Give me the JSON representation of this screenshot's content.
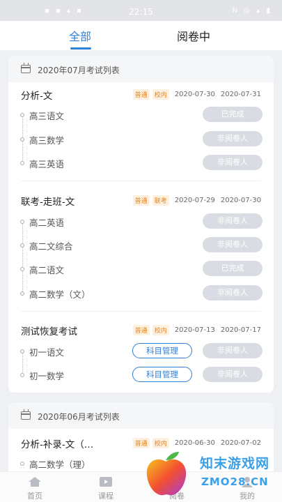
{
  "status_bar": {
    "time": "22:15",
    "left_icons": "▪ ▪ ▴ ▪",
    "right_icons": "N ◎ ▴ ▮"
  },
  "tabs": [
    {
      "label": "全部",
      "active": true
    },
    {
      "label": "阅卷中",
      "active": false
    }
  ],
  "sections": [
    {
      "header": "2020年07月考试列表",
      "exams": [
        {
          "title": "分析-文",
          "badges": [
            "普通",
            "校内"
          ],
          "start_date": "2020-07-30",
          "end_date": "2020-07-31",
          "subjects": [
            {
              "name": "高三语文",
              "status": "已完成"
            },
            {
              "name": "高三数学",
              "status": "非阅卷人"
            },
            {
              "name": "高三英语",
              "status": "非阅卷人"
            }
          ]
        },
        {
          "title": "联考-走班-文",
          "badges": [
            "普通",
            "联考"
          ],
          "start_date": "2020-07-29",
          "end_date": "2020-07-30",
          "subjects": [
            {
              "name": "高二英语",
              "status": "非阅卷人"
            },
            {
              "name": "高二文综合",
              "status": "非阅卷人"
            },
            {
              "name": "高二语文",
              "status": "已完成"
            },
            {
              "name": "高二数学（文）",
              "status": "非阅卷人"
            }
          ]
        },
        {
          "title": "测试恢复考试",
          "badges": [
            "普通",
            "校内"
          ],
          "start_date": "2020-07-13",
          "end_date": "2020-07-17",
          "subjects": [
            {
              "name": "初一语文",
              "action": "科目管理",
              "status": "非阅卷人"
            },
            {
              "name": "初一数学",
              "action": "科目管理",
              "status": "非阅卷人"
            }
          ]
        }
      ]
    },
    {
      "header": "2020年06月考试列表",
      "exams": [
        {
          "title": "分析-补录-文（…",
          "badges": [
            "普通",
            "校内"
          ],
          "start_date": "2020-06-30",
          "end_date": "2020-07-02",
          "subjects": [
            {
              "name": "高二数学（理）"
            }
          ]
        }
      ]
    }
  ],
  "bottom_nav": [
    {
      "label": "首页",
      "icon": "home-icon"
    },
    {
      "label": "课程",
      "icon": "video-icon"
    },
    {
      "label": "阅卷",
      "icon": "grading-icon"
    },
    {
      "label": "我的",
      "icon": "profile-icon"
    }
  ],
  "watermark": {
    "line1": "知末游戏网",
    "line2": "ZMO28.CN"
  },
  "colors": {
    "accent": "#2f80d8",
    "badge": "#e0862a",
    "pill_disabled": "#d9dce2"
  }
}
